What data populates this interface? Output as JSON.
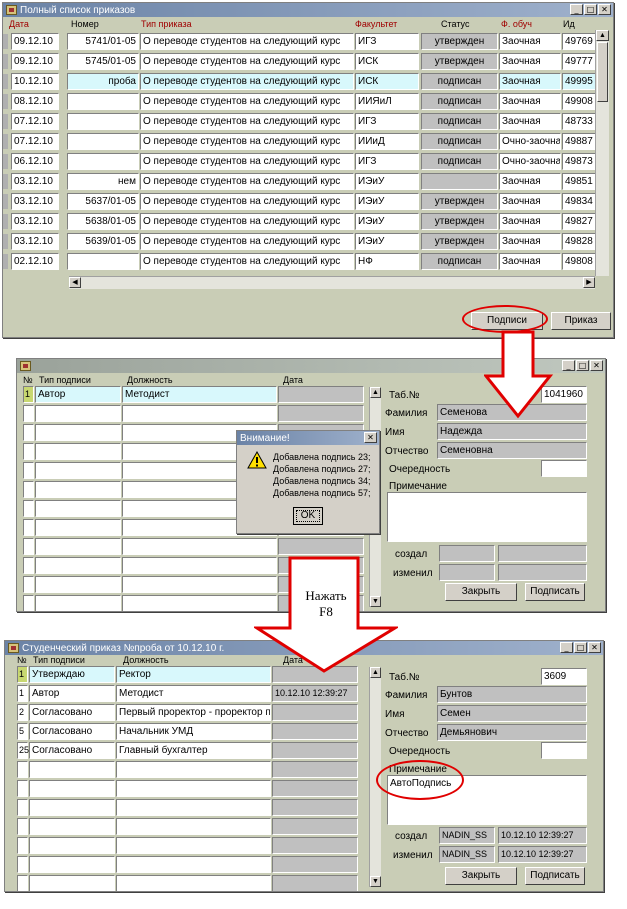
{
  "window1": {
    "title": "Полный список приказов",
    "headers": [
      "Дата",
      "Номер",
      "Тип приказа",
      "Факультет",
      "Статус",
      "Ф. обуч",
      "Ид"
    ],
    "rows": [
      {
        "date": "09.12.10",
        "num": "5741/01-05",
        "type": "О переводе студентов на следующий курс",
        "fac": "ИГЗ",
        "status": "утвержден",
        "form": "Заочная",
        "id": "49769"
      },
      {
        "date": "09.12.10",
        "num": "5745/01-05",
        "type": "О переводе студентов на следующий курс",
        "fac": "ИСК",
        "status": "утвержден",
        "form": "Заочная",
        "id": "49777"
      },
      {
        "date": "10.12.10",
        "num": "проба",
        "type": "О переводе студентов на следующий курс",
        "fac": "ИСК",
        "status": "подписан",
        "form": "Заочная",
        "id": "49995"
      },
      {
        "date": "08.12.10",
        "num": "",
        "type": "О переводе студентов на следующий курс",
        "fac": "ИИЯиЛ",
        "status": "подписан",
        "form": "Заочная",
        "id": "49908"
      },
      {
        "date": "07.12.10",
        "num": "",
        "type": "О переводе студентов на следующий курс",
        "fac": "ИГЗ",
        "status": "подписан",
        "form": "Заочная",
        "id": "48733"
      },
      {
        "date": "07.12.10",
        "num": "",
        "type": "О переводе студентов на следующий курс",
        "fac": "ИИиД",
        "status": "подписан",
        "form": "Очно-заочная",
        "id": "49887"
      },
      {
        "date": "06.12.10",
        "num": "",
        "type": "О переводе студентов на следующий курс",
        "fac": "ИГЗ",
        "status": "подписан",
        "form": "Очно-заочная",
        "id": "49873"
      },
      {
        "date": "03.12.10",
        "num": "нем",
        "type": "О переводе студентов на следующий курс",
        "fac": "ИЭиУ",
        "status": "",
        "form": "Заочная",
        "id": "49851"
      },
      {
        "date": "03.12.10",
        "num": "5637/01-05",
        "type": "О переводе студентов на следующий курс",
        "fac": "ИЭиУ",
        "status": "утвержден",
        "form": "Заочная",
        "id": "49834"
      },
      {
        "date": "03.12.10",
        "num": "5638/01-05",
        "type": "О переводе студентов на следующий курс",
        "fac": "ИЭиУ",
        "status": "утвержден",
        "form": "Заочная",
        "id": "49827"
      },
      {
        "date": "03.12.10",
        "num": "5639/01-05",
        "type": "О переводе студентов на следующий курс",
        "fac": "ИЭиУ",
        "status": "утвержден",
        "form": "Заочная",
        "id": "49828"
      },
      {
        "date": "02.12.10",
        "num": "",
        "type": "О переводе студентов на следующий курс",
        "fac": "НФ",
        "status": "подписан",
        "form": "Заочная",
        "id": "49808"
      }
    ],
    "btn_signs": "Подписи",
    "btn_order": "Приказ"
  },
  "window2": {
    "headers": [
      "№",
      "Тип подписи",
      "Должность",
      "Дата"
    ],
    "rows": [
      {
        "n": "1",
        "type": "Автор",
        "pos": "Методист",
        "date": ""
      }
    ],
    "tab_label": "Таб.№",
    "tab_value": "1041960",
    "surname_label": "Фамилия",
    "surname": "Семенова",
    "name_label": "Имя",
    "name": "Надежда",
    "patronymic_label": "Отчество",
    "patronymic": "Семеновна",
    "order_label": "Очередность",
    "note_label": "Примечание",
    "created_label": "создал",
    "changed_label": "изменил",
    "btn_close": "Закрыть",
    "btn_sign": "Подписать"
  },
  "dialog": {
    "title": "Внимание!",
    "lines": [
      "Добавлена подпись 23;",
      "Добавлена подпись 27;",
      "Добавлена подпись 34;",
      "Добавлена подпись 57;"
    ],
    "ok": "OK"
  },
  "annotation": {
    "line1": "Нажать",
    "line2": "F8"
  },
  "window3": {
    "title": "Студенческий приказ №проба от 10.12.10 г.",
    "headers": [
      "№",
      "Тип подписи",
      "Должность",
      "Дата"
    ],
    "rows": [
      {
        "n": "1",
        "type": "Утверждаю",
        "pos": "Ректор",
        "date": ""
      },
      {
        "n": "1",
        "type": "Автор",
        "pos": "Методист",
        "date": "10.12.10 12:39:27"
      },
      {
        "n": "2",
        "type": "Согласовано",
        "pos": "Первый проректор - проректор по",
        "date": ""
      },
      {
        "n": "5",
        "type": "Согласовано",
        "pos": "Начальник УМД",
        "date": ""
      },
      {
        "n": "25",
        "type": "Согласовано",
        "pos": "Главный бухгалтер",
        "date": ""
      }
    ],
    "tab_label": "Таб.№",
    "tab_value": "3609",
    "surname_label": "Фамилия",
    "surname": "Бунтов",
    "name_label": "Имя",
    "name": "Семен",
    "patronymic_label": "Отчество",
    "patronymic": "Демьянович",
    "order_label": "Очередность",
    "note_label": "Примечание",
    "note_value": "АвтоПодпись",
    "created_label": "создал",
    "created_user": "NADIN_SS",
    "created_time": "10.12.10 12:39:27",
    "changed_label": "изменил",
    "changed_user": "NADIN_SS",
    "changed_time": "10.12.10 12:39:27",
    "btn_close": "Закрыть",
    "btn_sign": "Подписать"
  },
  "colors": {
    "window_bg": "#c9cdb6",
    "titlebar_active": "#6b83a6",
    "highlight_row": "#d8f8fc",
    "annotation_red": "#e00000",
    "header_red": "#a00000"
  }
}
